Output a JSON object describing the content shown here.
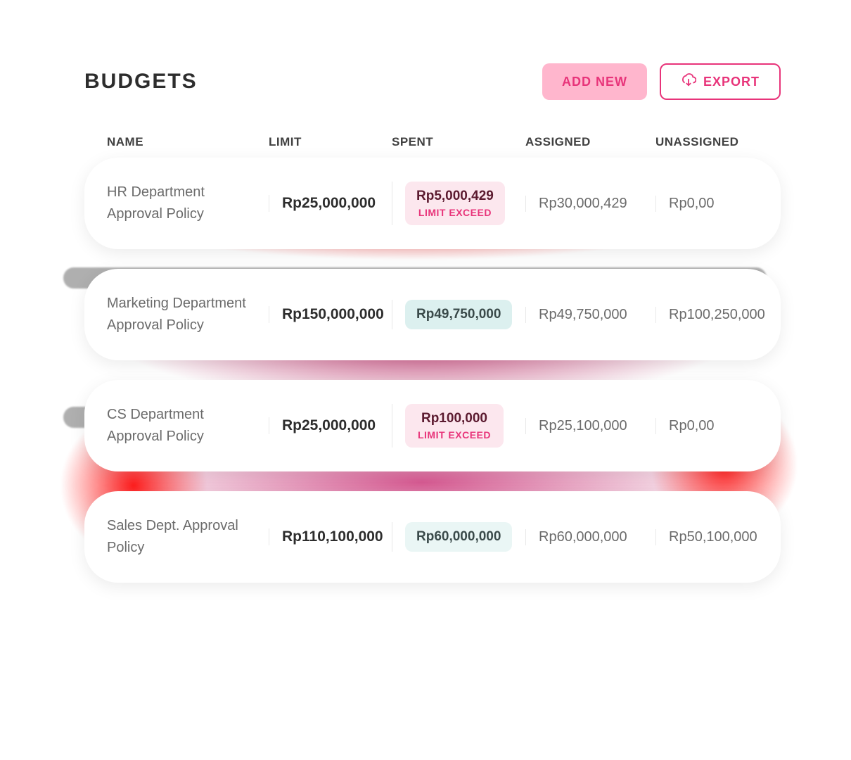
{
  "header": {
    "title": "BUDGETS",
    "add_label": "ADD NEW",
    "export_label": "EXPORT"
  },
  "columns": {
    "name": "NAME",
    "limit": "LIMIT",
    "spent": "SPENT",
    "assigned": "ASSIGNED",
    "unassigned": "UNASSIGNED"
  },
  "rows": [
    {
      "name": "HR Department Approval Policy",
      "limit": "Rp25,000,000",
      "spent": "Rp5,000,429",
      "spent_flag": "LIMIT EXCEED",
      "spent_style": "pink",
      "assigned": "Rp30,000,429",
      "unassigned": "Rp0,00"
    },
    {
      "name": "Marketing Department Approval Policy",
      "limit": "Rp150,000,000",
      "spent": "Rp49,750,000",
      "spent_flag": "",
      "spent_style": "teal",
      "assigned": "Rp49,750,000",
      "unassigned": "Rp100,250,000"
    },
    {
      "name": "CS Department Approval Policy",
      "limit": "Rp25,000,000",
      "spent": "Rp100,000",
      "spent_flag": "LIMIT EXCEED",
      "spent_style": "pink",
      "assigned": "Rp25,100,000",
      "unassigned": "Rp0,00"
    },
    {
      "name": "Sales Dept. Approval Policy",
      "limit": "Rp110,100,000",
      "spent": "Rp60,000,000",
      "spent_flag": "",
      "spent_style": "tealpale",
      "assigned": "Rp60,000,000",
      "unassigned": "Rp50,100,000"
    }
  ]
}
